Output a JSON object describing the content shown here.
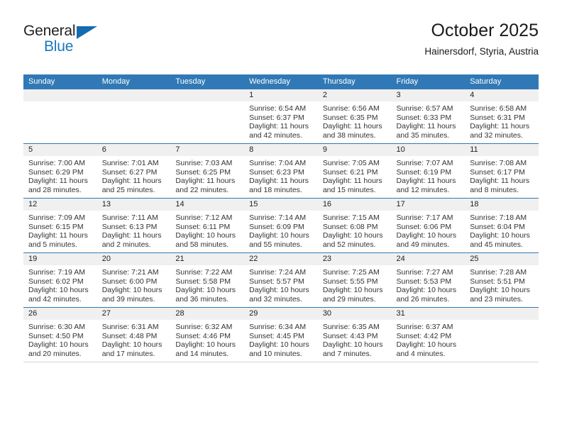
{
  "brand": {
    "name_part1": "General",
    "name_part2": "Blue",
    "logo_icon": "triangle-logo-icon",
    "color_dark": "#231f20",
    "color_blue": "#1878be"
  },
  "header": {
    "title": "October 2025",
    "subtitle": "Hainersdorf, Styria, Austria"
  },
  "colors": {
    "header_row_bg": "#3079b6",
    "daynum_band_bg": "#f0f0f0",
    "row_divider": "#3079b6",
    "text": "#333333"
  },
  "calendar": {
    "weekday_headers": [
      "Sunday",
      "Monday",
      "Tuesday",
      "Wednesday",
      "Thursday",
      "Friday",
      "Saturday"
    ],
    "weeks": [
      [
        {
          "day": "",
          "sunrise": "",
          "sunset": "",
          "daylight_line1": "",
          "daylight_line2": "",
          "empty": true
        },
        {
          "day": "",
          "sunrise": "",
          "sunset": "",
          "daylight_line1": "",
          "daylight_line2": "",
          "empty": true
        },
        {
          "day": "",
          "sunrise": "",
          "sunset": "",
          "daylight_line1": "",
          "daylight_line2": "",
          "empty": true
        },
        {
          "day": "1",
          "sunrise": "Sunrise: 6:54 AM",
          "sunset": "Sunset: 6:37 PM",
          "daylight_line1": "Daylight: 11 hours",
          "daylight_line2": "and 42 minutes."
        },
        {
          "day": "2",
          "sunrise": "Sunrise: 6:56 AM",
          "sunset": "Sunset: 6:35 PM",
          "daylight_line1": "Daylight: 11 hours",
          "daylight_line2": "and 38 minutes."
        },
        {
          "day": "3",
          "sunrise": "Sunrise: 6:57 AM",
          "sunset": "Sunset: 6:33 PM",
          "daylight_line1": "Daylight: 11 hours",
          "daylight_line2": "and 35 minutes."
        },
        {
          "day": "4",
          "sunrise": "Sunrise: 6:58 AM",
          "sunset": "Sunset: 6:31 PM",
          "daylight_line1": "Daylight: 11 hours",
          "daylight_line2": "and 32 minutes."
        }
      ],
      [
        {
          "day": "5",
          "sunrise": "Sunrise: 7:00 AM",
          "sunset": "Sunset: 6:29 PM",
          "daylight_line1": "Daylight: 11 hours",
          "daylight_line2": "and 28 minutes."
        },
        {
          "day": "6",
          "sunrise": "Sunrise: 7:01 AM",
          "sunset": "Sunset: 6:27 PM",
          "daylight_line1": "Daylight: 11 hours",
          "daylight_line2": "and 25 minutes."
        },
        {
          "day": "7",
          "sunrise": "Sunrise: 7:03 AM",
          "sunset": "Sunset: 6:25 PM",
          "daylight_line1": "Daylight: 11 hours",
          "daylight_line2": "and 22 minutes."
        },
        {
          "day": "8",
          "sunrise": "Sunrise: 7:04 AM",
          "sunset": "Sunset: 6:23 PM",
          "daylight_line1": "Daylight: 11 hours",
          "daylight_line2": "and 18 minutes."
        },
        {
          "day": "9",
          "sunrise": "Sunrise: 7:05 AM",
          "sunset": "Sunset: 6:21 PM",
          "daylight_line1": "Daylight: 11 hours",
          "daylight_line2": "and 15 minutes."
        },
        {
          "day": "10",
          "sunrise": "Sunrise: 7:07 AM",
          "sunset": "Sunset: 6:19 PM",
          "daylight_line1": "Daylight: 11 hours",
          "daylight_line2": "and 12 minutes."
        },
        {
          "day": "11",
          "sunrise": "Sunrise: 7:08 AM",
          "sunset": "Sunset: 6:17 PM",
          "daylight_line1": "Daylight: 11 hours",
          "daylight_line2": "and 8 minutes."
        }
      ],
      [
        {
          "day": "12",
          "sunrise": "Sunrise: 7:09 AM",
          "sunset": "Sunset: 6:15 PM",
          "daylight_line1": "Daylight: 11 hours",
          "daylight_line2": "and 5 minutes."
        },
        {
          "day": "13",
          "sunrise": "Sunrise: 7:11 AM",
          "sunset": "Sunset: 6:13 PM",
          "daylight_line1": "Daylight: 11 hours",
          "daylight_line2": "and 2 minutes."
        },
        {
          "day": "14",
          "sunrise": "Sunrise: 7:12 AM",
          "sunset": "Sunset: 6:11 PM",
          "daylight_line1": "Daylight: 10 hours",
          "daylight_line2": "and 58 minutes."
        },
        {
          "day": "15",
          "sunrise": "Sunrise: 7:14 AM",
          "sunset": "Sunset: 6:09 PM",
          "daylight_line1": "Daylight: 10 hours",
          "daylight_line2": "and 55 minutes."
        },
        {
          "day": "16",
          "sunrise": "Sunrise: 7:15 AM",
          "sunset": "Sunset: 6:08 PM",
          "daylight_line1": "Daylight: 10 hours",
          "daylight_line2": "and 52 minutes."
        },
        {
          "day": "17",
          "sunrise": "Sunrise: 7:17 AM",
          "sunset": "Sunset: 6:06 PM",
          "daylight_line1": "Daylight: 10 hours",
          "daylight_line2": "and 49 minutes."
        },
        {
          "day": "18",
          "sunrise": "Sunrise: 7:18 AM",
          "sunset": "Sunset: 6:04 PM",
          "daylight_line1": "Daylight: 10 hours",
          "daylight_line2": "and 45 minutes."
        }
      ],
      [
        {
          "day": "19",
          "sunrise": "Sunrise: 7:19 AM",
          "sunset": "Sunset: 6:02 PM",
          "daylight_line1": "Daylight: 10 hours",
          "daylight_line2": "and 42 minutes."
        },
        {
          "day": "20",
          "sunrise": "Sunrise: 7:21 AM",
          "sunset": "Sunset: 6:00 PM",
          "daylight_line1": "Daylight: 10 hours",
          "daylight_line2": "and 39 minutes."
        },
        {
          "day": "21",
          "sunrise": "Sunrise: 7:22 AM",
          "sunset": "Sunset: 5:58 PM",
          "daylight_line1": "Daylight: 10 hours",
          "daylight_line2": "and 36 minutes."
        },
        {
          "day": "22",
          "sunrise": "Sunrise: 7:24 AM",
          "sunset": "Sunset: 5:57 PM",
          "daylight_line1": "Daylight: 10 hours",
          "daylight_line2": "and 32 minutes."
        },
        {
          "day": "23",
          "sunrise": "Sunrise: 7:25 AM",
          "sunset": "Sunset: 5:55 PM",
          "daylight_line1": "Daylight: 10 hours",
          "daylight_line2": "and 29 minutes."
        },
        {
          "day": "24",
          "sunrise": "Sunrise: 7:27 AM",
          "sunset": "Sunset: 5:53 PM",
          "daylight_line1": "Daylight: 10 hours",
          "daylight_line2": "and 26 minutes."
        },
        {
          "day": "25",
          "sunrise": "Sunrise: 7:28 AM",
          "sunset": "Sunset: 5:51 PM",
          "daylight_line1": "Daylight: 10 hours",
          "daylight_line2": "and 23 minutes."
        }
      ],
      [
        {
          "day": "26",
          "sunrise": "Sunrise: 6:30 AM",
          "sunset": "Sunset: 4:50 PM",
          "daylight_line1": "Daylight: 10 hours",
          "daylight_line2": "and 20 minutes."
        },
        {
          "day": "27",
          "sunrise": "Sunrise: 6:31 AM",
          "sunset": "Sunset: 4:48 PM",
          "daylight_line1": "Daylight: 10 hours",
          "daylight_line2": "and 17 minutes."
        },
        {
          "day": "28",
          "sunrise": "Sunrise: 6:32 AM",
          "sunset": "Sunset: 4:46 PM",
          "daylight_line1": "Daylight: 10 hours",
          "daylight_line2": "and 14 minutes."
        },
        {
          "day": "29",
          "sunrise": "Sunrise: 6:34 AM",
          "sunset": "Sunset: 4:45 PM",
          "daylight_line1": "Daylight: 10 hours",
          "daylight_line2": "and 10 minutes."
        },
        {
          "day": "30",
          "sunrise": "Sunrise: 6:35 AM",
          "sunset": "Sunset: 4:43 PM",
          "daylight_line1": "Daylight: 10 hours",
          "daylight_line2": "and 7 minutes."
        },
        {
          "day": "31",
          "sunrise": "Sunrise: 6:37 AM",
          "sunset": "Sunset: 4:42 PM",
          "daylight_line1": "Daylight: 10 hours",
          "daylight_line2": "and 4 minutes."
        },
        {
          "day": "",
          "sunrise": "",
          "sunset": "",
          "daylight_line1": "",
          "daylight_line2": "",
          "empty": true
        }
      ]
    ]
  }
}
